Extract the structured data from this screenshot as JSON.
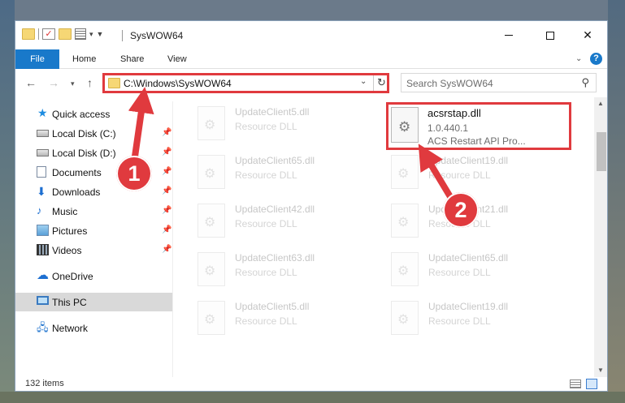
{
  "window": {
    "title": "SysWOW64"
  },
  "ribbon": {
    "tabs": [
      "File",
      "Home",
      "Share",
      "View"
    ],
    "help_icon": "?"
  },
  "navigation": {
    "address": "C:\\Windows\\SysWOW64",
    "search_placeholder": "Search SysWOW64"
  },
  "sidebar": {
    "items": [
      {
        "label": "Quick access",
        "icon": "star-icon"
      },
      {
        "label": "Local Disk (C:)",
        "icon": "drive-icon",
        "pinned": true
      },
      {
        "label": "Local Disk (D:)",
        "icon": "drive-icon",
        "pinned": true
      },
      {
        "label": "Documents",
        "icon": "documents-icon",
        "pinned": true
      },
      {
        "label": "Downloads",
        "icon": "download-icon",
        "pinned": true
      },
      {
        "label": "Music",
        "icon": "music-icon",
        "pinned": true
      },
      {
        "label": "Pictures",
        "icon": "pictures-icon",
        "pinned": true
      },
      {
        "label": "Videos",
        "icon": "videos-icon",
        "pinned": true
      },
      {
        "label": "OneDrive",
        "icon": "cloud-icon"
      },
      {
        "label": "This PC",
        "icon": "computer-icon",
        "selected": true
      },
      {
        "label": "Network",
        "icon": "network-icon"
      }
    ]
  },
  "files": {
    "background_tiles": [
      {
        "name": "UpdateClient5.dll",
        "type": "Resource DLL"
      },
      {
        "name": "UpdateClient65.dll",
        "type": "Resource DLL"
      },
      {
        "name": "UpdateClient19.dll",
        "type": "Resource DLL"
      },
      {
        "name": "UpdateClient42.dll",
        "type": "Resource DLL"
      },
      {
        "name": "UpdateClient21.dll",
        "type": "Resource DLL"
      },
      {
        "name": "UpdateClient63.dll",
        "type": "Resource DLL"
      },
      {
        "name": "UpdateClient65.dll",
        "type": "Resource DLL"
      },
      {
        "name": "UpdateClient5.dll",
        "type": "Resource DLL"
      },
      {
        "name": "UpdateClient19.dll",
        "type": "Resource DLL"
      }
    ],
    "highlighted": {
      "name": "acsrstap.dll",
      "version": "1.0.440.1",
      "description": "ACS Restart API Pro..."
    }
  },
  "status": {
    "item_count": "132 items"
  },
  "annotations": {
    "step1": "1",
    "step2": "2",
    "highlight_color": "#e03a3e"
  }
}
